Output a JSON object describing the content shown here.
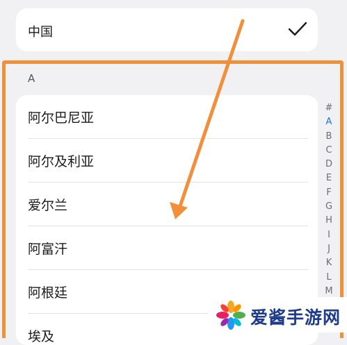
{
  "selected_region": {
    "label": "中国"
  },
  "section": {
    "header": "A"
  },
  "countries": [
    {
      "label": "阿尔巴尼亚"
    },
    {
      "label": "阿尔及利亚"
    },
    {
      "label": "爱尔兰"
    },
    {
      "label": "阿富汗"
    },
    {
      "label": "阿根廷"
    },
    {
      "label": "埃及"
    }
  ],
  "index_bar": {
    "letters": [
      "#",
      "A",
      "B",
      "C",
      "D",
      "E",
      "F",
      "G",
      "H",
      "I",
      "J",
      "K",
      "L",
      "M"
    ],
    "active": "A"
  },
  "watermark": {
    "text": "爱酱手游网"
  },
  "colors": {
    "highlight": "#f28f3b",
    "accent": "#1a73e8"
  }
}
